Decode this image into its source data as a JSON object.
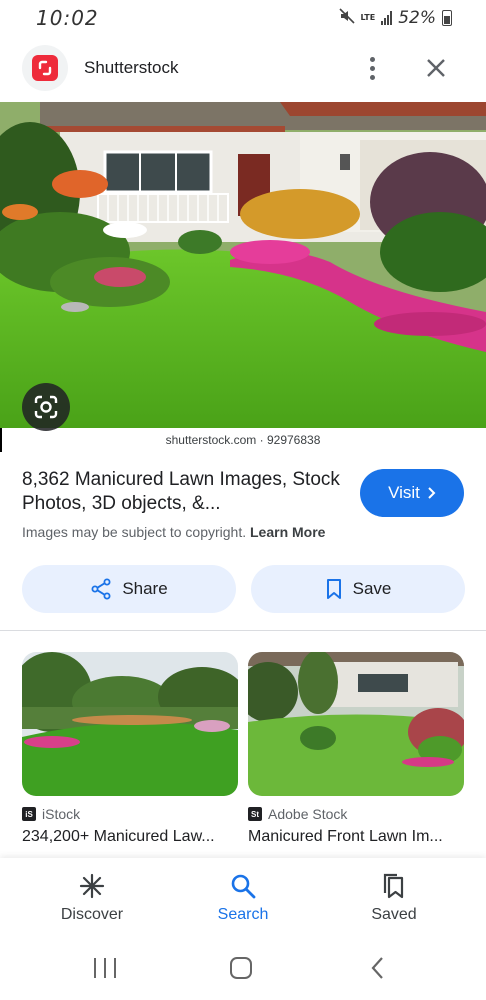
{
  "status_bar": {
    "time": "10:02",
    "network": "LTE",
    "battery": "52%"
  },
  "header": {
    "site_title": "Shutterstock"
  },
  "result": {
    "source_caption": "shutterstock.com · 92976838",
    "title": "8,362 Manicured Lawn Images, Stock Photos, 3D objects, &...",
    "visit_label": "Visit",
    "copyright_text": "Images may be subject to copyright.",
    "learn_more": "Learn More",
    "share_label": "Share",
    "save_label": "Save"
  },
  "related": [
    {
      "source": "iStock",
      "source_badge": "iS",
      "title": "234,200+ Manicured Law..."
    },
    {
      "source": "Adobe Stock",
      "source_badge": "St",
      "title": "Manicured Front Lawn Im..."
    }
  ],
  "bottom_nav": [
    {
      "label": "Discover",
      "icon": "asterisk-icon"
    },
    {
      "label": "Search",
      "icon": "search-icon",
      "active": true
    },
    {
      "label": "Saved",
      "icon": "bookmarks-icon"
    }
  ],
  "colors": {
    "accent": "#1a73e8",
    "chip_bg": "#e8f0fe",
    "shutterstock_red": "#ee2b3b"
  }
}
